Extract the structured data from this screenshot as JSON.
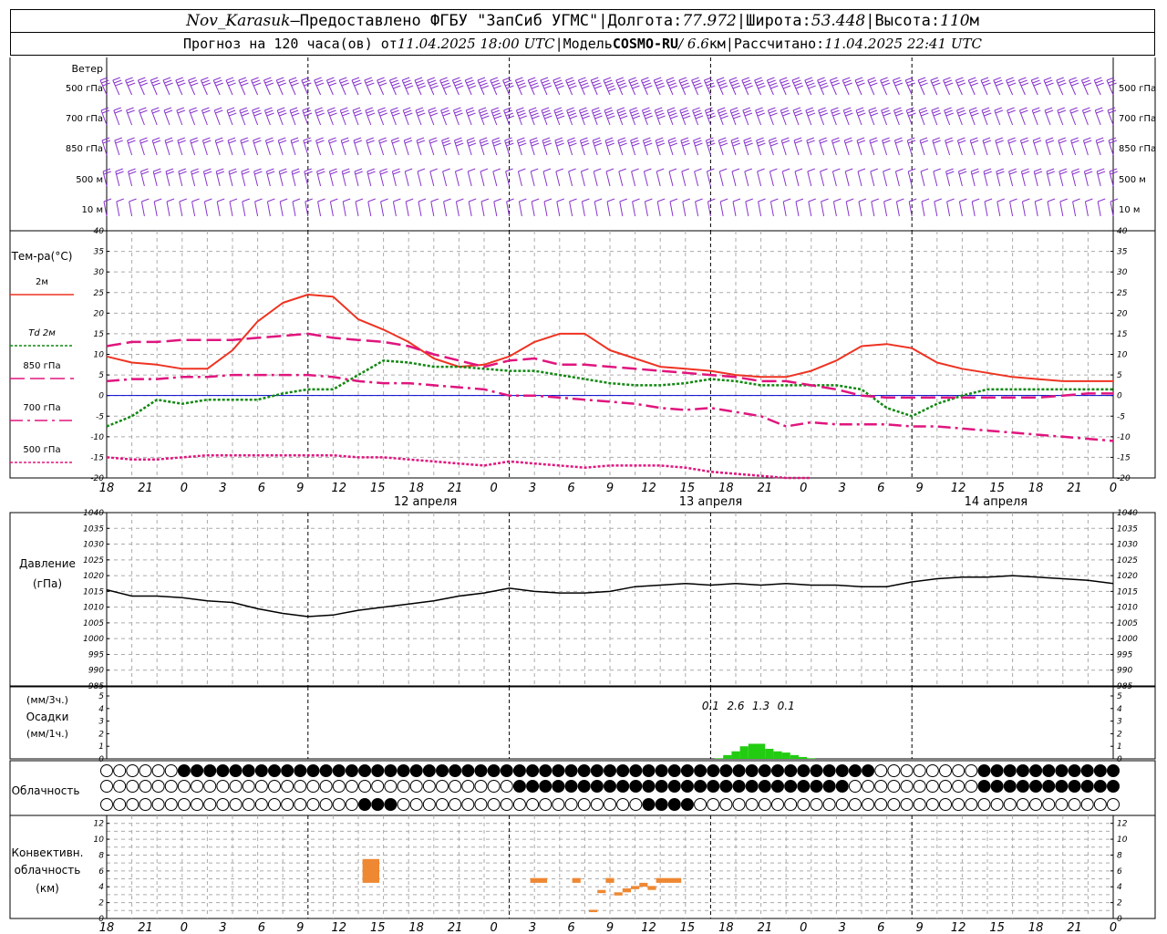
{
  "header": {
    "station": "Nov_Karasuk",
    "dash": " – ",
    "provider": "Предоставлено ФГБУ \"ЗапСиб УГМС\"",
    "sep": " | ",
    "lon_label": "Долгота: ",
    "lon_value": "77.972",
    "lat_label": "Широта: ",
    "lat_value": "53.448",
    "alt_label": "Высота: ",
    "alt_value": "110",
    "alt_unit": "м",
    "forecast_label": "Прогноз на 120 часа(ов) от ",
    "forecast_start": "11.04.2025 18:00 UTC",
    "model_label": "Модель ",
    "model_name": "COSMO-RU",
    "model_res": " / 6.6",
    "model_res_unit": "км",
    "calc_label": "Рассчитано: ",
    "calc_time": "11.04.2025 22:41 UTC"
  },
  "labels": {
    "wind": "Ветер",
    "wind_levels": [
      "500 гПа",
      "700 гПа",
      "850 гПа",
      "500  м",
      "10   м"
    ],
    "temp_title": "Тем-ра(°C)",
    "legend": [
      "2м",
      "Td  2м",
      "850 гПа",
      "700 гПа",
      "500 гПа"
    ],
    "pressure": "Давление",
    "pressure_unit": "(гПа)",
    "precip_unit3": "(мм/3ч.)",
    "precip": "Осадки",
    "precip_unit1": "(мм/1ч.)",
    "clouds": "Облачность",
    "conv1": "Конвективн.",
    "conv2": "облачность",
    "conv_unit": "(км)"
  },
  "colors": {
    "t2m": "#ee3322",
    "td2m": "#118811",
    "t850": "#e0157e",
    "t700": "#e0157e",
    "t500": "#e0157e",
    "wind": "#8833cc",
    "pressure": "#000000",
    "precip": "#22cc11",
    "conv": "#ee8833",
    "zero_line": "#0000cc"
  },
  "chart_data": [
    {
      "type": "wind_barbs",
      "levels": [
        "500 гПа",
        "700 гПа",
        "850 гПа",
        "500  м",
        "10   м"
      ],
      "note": "shown as wind barbs only; directions are predominantly westerly, speeds decreasing toward day 2"
    },
    {
      "type": "line",
      "title": "Тем-ра(°C)",
      "x_ticks": [
        "18",
        "21",
        "0",
        "3",
        "6",
        "9",
        "12",
        "15",
        "18",
        "21",
        "0",
        "3",
        "6",
        "9",
        "12",
        "15",
        "18",
        "21",
        "0",
        "3",
        "6",
        "9",
        "12",
        "15",
        "18",
        "21",
        "0"
      ],
      "day_labels": [
        "12 апреля",
        "13 апреля",
        "14 апреля"
      ],
      "ylim": [
        -20,
        40
      ],
      "y_ticks": [
        40,
        35,
        30,
        25,
        20,
        15,
        10,
        5,
        0,
        -5,
        -10,
        -15,
        -20
      ],
      "hours": [
        0,
        3,
        6,
        9,
        12,
        15,
        18,
        21,
        24,
        27,
        30,
        33,
        36,
        39,
        42,
        45,
        48,
        51,
        54,
        57,
        60,
        63,
        66,
        69,
        72,
        75,
        78,
        81,
        84,
        87,
        90,
        93,
        96,
        99,
        102,
        105,
        108,
        111,
        114,
        117,
        120
      ],
      "series": [
        {
          "name": "2м",
          "style": "solid",
          "values": [
            9.5,
            8,
            7.5,
            6.5,
            6.5,
            11,
            18,
            22.5,
            24.5,
            24,
            18.5,
            16,
            13,
            9,
            7,
            7.5,
            9.5,
            13,
            15,
            15,
            11,
            9,
            7,
            6.5,
            6,
            5,
            4.5,
            4.5,
            6,
            8.5,
            12,
            12.5,
            11.5,
            8,
            6.5,
            5.5,
            4.5,
            4,
            3.5,
            3.5,
            3.5
          ]
        },
        {
          "name": "Td  2м",
          "style": "dotted",
          "values": [
            -7.5,
            -5,
            -1,
            -2,
            -1,
            -1,
            -1,
            0.5,
            1.5,
            1.5,
            5,
            8.5,
            8,
            7,
            7,
            6.5,
            6,
            6,
            5,
            4,
            3,
            2.5,
            2.5,
            3,
            4,
            3.5,
            2.5,
            2.5,
            2.5,
            2.5,
            1.5,
            -3,
            -5,
            -2,
            0,
            1.5,
            1.5,
            1.5,
            1.5,
            1.5,
            1.5
          ]
        },
        {
          "name": "850 гПа",
          "style": "longdash",
          "values": [
            12,
            13,
            13,
            13.5,
            13.5,
            13.5,
            14,
            14.5,
            15,
            14,
            13.5,
            13,
            12,
            10,
            8.5,
            7,
            8.5,
            9,
            7.5,
            7.5,
            7,
            6.5,
            6,
            5.5,
            5,
            4.5,
            3.5,
            3.5,
            2.5,
            1.5,
            0,
            -0.5,
            -0.5,
            -0.5,
            -0.5,
            -0.5,
            -0.5,
            -0.5,
            0,
            0.5,
            0.5
          ]
        },
        {
          "name": "700 гПа",
          "style": "dashdot",
          "values": [
            3.5,
            4,
            4,
            4.5,
            4.5,
            5,
            5,
            5,
            5,
            4.5,
            3.5,
            3,
            3,
            2.5,
            2,
            1.5,
            0,
            0,
            -0.5,
            -1,
            -1.5,
            -2,
            -3,
            -3.5,
            -3,
            -4,
            -5,
            -7.5,
            -6.5,
            -7,
            -7,
            -7,
            -7.5,
            -7.5,
            -8,
            -8.5,
            -9,
            -9.5,
            -10,
            -10.5,
            -11
          ]
        },
        {
          "name": "500 гПа",
          "style": "finedash",
          "values": [
            -15,
            -15.5,
            -15.5,
            -15,
            -14.5,
            -14.5,
            -14.5,
            -14.5,
            -14.5,
            -14.5,
            -15,
            -15,
            -15.5,
            -16,
            -16.5,
            -17,
            -16,
            -16.5,
            -17,
            -17.5,
            -17,
            -17,
            -17,
            -17.5,
            -18.5,
            -19,
            -19.5,
            -20,
            -20
          ]
        }
      ]
    },
    {
      "type": "line",
      "title": "Давление",
      "ylabel": "(гПа)",
      "ylim": [
        985,
        1040
      ],
      "y_ticks": [
        1040,
        1035,
        1030,
        1025,
        1020,
        1015,
        1010,
        1005,
        1000,
        995,
        990,
        985
      ],
      "hours": [
        0,
        3,
        6,
        9,
        12,
        15,
        18,
        21,
        24,
        27,
        30,
        33,
        36,
        39,
        42,
        45,
        48,
        51,
        54,
        57,
        60,
        63,
        66,
        69,
        72,
        75,
        78,
        81,
        84,
        87,
        90,
        93,
        96,
        99,
        102,
        105,
        108,
        111,
        114,
        117,
        120
      ],
      "series": [
        {
          "name": "Давление",
          "values": [
            1015.5,
            1013.5,
            1013.5,
            1013,
            1012,
            1011.5,
            1009.5,
            1008,
            1007,
            1007.5,
            1009,
            1010,
            1011,
            1012,
            1013.5,
            1014.5,
            1016,
            1015,
            1014.5,
            1014.5,
            1015,
            1016.5,
            1017,
            1017.5,
            1017,
            1017.5,
            1017,
            1017.5,
            1017,
            1017,
            1016.5,
            1016.5,
            1018,
            1019,
            1019.5,
            1019.5,
            1020,
            1019.5,
            1019,
            1018.5,
            1017.5
          ]
        }
      ]
    },
    {
      "type": "bar",
      "title": "Осадки",
      "ylabel": "(мм/3ч.) (мм/1ч.)",
      "ylim": [
        0,
        5
      ],
      "y_ticks": [
        5,
        4,
        3,
        2,
        1,
        0
      ],
      "bars_hourly": [
        {
          "hour": 73,
          "value": 0.05
        },
        {
          "hour": 74,
          "value": 0.3
        },
        {
          "hour": 75,
          "value": 0.6
        },
        {
          "hour": 76,
          "value": 1.0
        },
        {
          "hour": 77,
          "value": 1.2
        },
        {
          "hour": 78,
          "value": 1.2
        },
        {
          "hour": 79,
          "value": 0.8
        },
        {
          "hour": 80,
          "value": 0.6
        },
        {
          "hour": 81,
          "value": 0.5
        },
        {
          "hour": 82,
          "value": 0.3
        },
        {
          "hour": 83,
          "value": 0.15
        },
        {
          "hour": 84,
          "value": 0.05
        }
      ],
      "totals_3h": [
        {
          "hour": 72,
          "text": "0.1"
        },
        {
          "hour": 75,
          "text": "2.6"
        },
        {
          "hour": 78,
          "text": "1.3"
        },
        {
          "hour": 81,
          "text": "0.1"
        }
      ]
    },
    {
      "type": "cloud_cover",
      "title": "Облачность",
      "rows": 3,
      "steps": 79,
      "note": "three layers of octa cloud symbols; upper layer mostly overcast during days 1-3, middle layer overcast in the second half, lower layer mostly clear"
    },
    {
      "type": "bar",
      "title": "Конвективн. облачность",
      "ylabel": "(км)",
      "ylim": [
        0,
        13
      ],
      "y_ticks": [
        12,
        10,
        8,
        6,
        4,
        2,
        0
      ],
      "segments": [
        {
          "hour_start": 30.5,
          "hour_end": 32.5,
          "base": 4.5,
          "top": 7.5
        },
        {
          "hour_start": 50.5,
          "hour_end": 52.5,
          "base": 4.5,
          "top": 5.1
        },
        {
          "hour_start": 55.5,
          "hour_end": 56.5,
          "base": 4.5,
          "top": 5.1
        },
        {
          "hour_start": 57.5,
          "hour_end": 58.5,
          "base": 0.8,
          "top": 1.1
        },
        {
          "hour_start": 58.5,
          "hour_end": 59.5,
          "base": 3.2,
          "top": 3.6
        },
        {
          "hour_start": 59.5,
          "hour_end": 60.5,
          "base": 4.5,
          "top": 5.1
        },
        {
          "hour_start": 60.5,
          "hour_end": 61.5,
          "base": 2.9,
          "top": 3.3
        },
        {
          "hour_start": 61.5,
          "hour_end": 62.5,
          "base": 3.3,
          "top": 3.8
        },
        {
          "hour_start": 62.5,
          "hour_end": 63.5,
          "base": 3.7,
          "top": 4.1
        },
        {
          "hour_start": 63.5,
          "hour_end": 64.5,
          "base": 4.0,
          "top": 4.5
        },
        {
          "hour_start": 64.5,
          "hour_end": 65.5,
          "base": 3.6,
          "top": 4.1
        },
        {
          "hour_start": 65.5,
          "hour_end": 68.5,
          "base": 4.5,
          "top": 5.1
        }
      ]
    }
  ]
}
